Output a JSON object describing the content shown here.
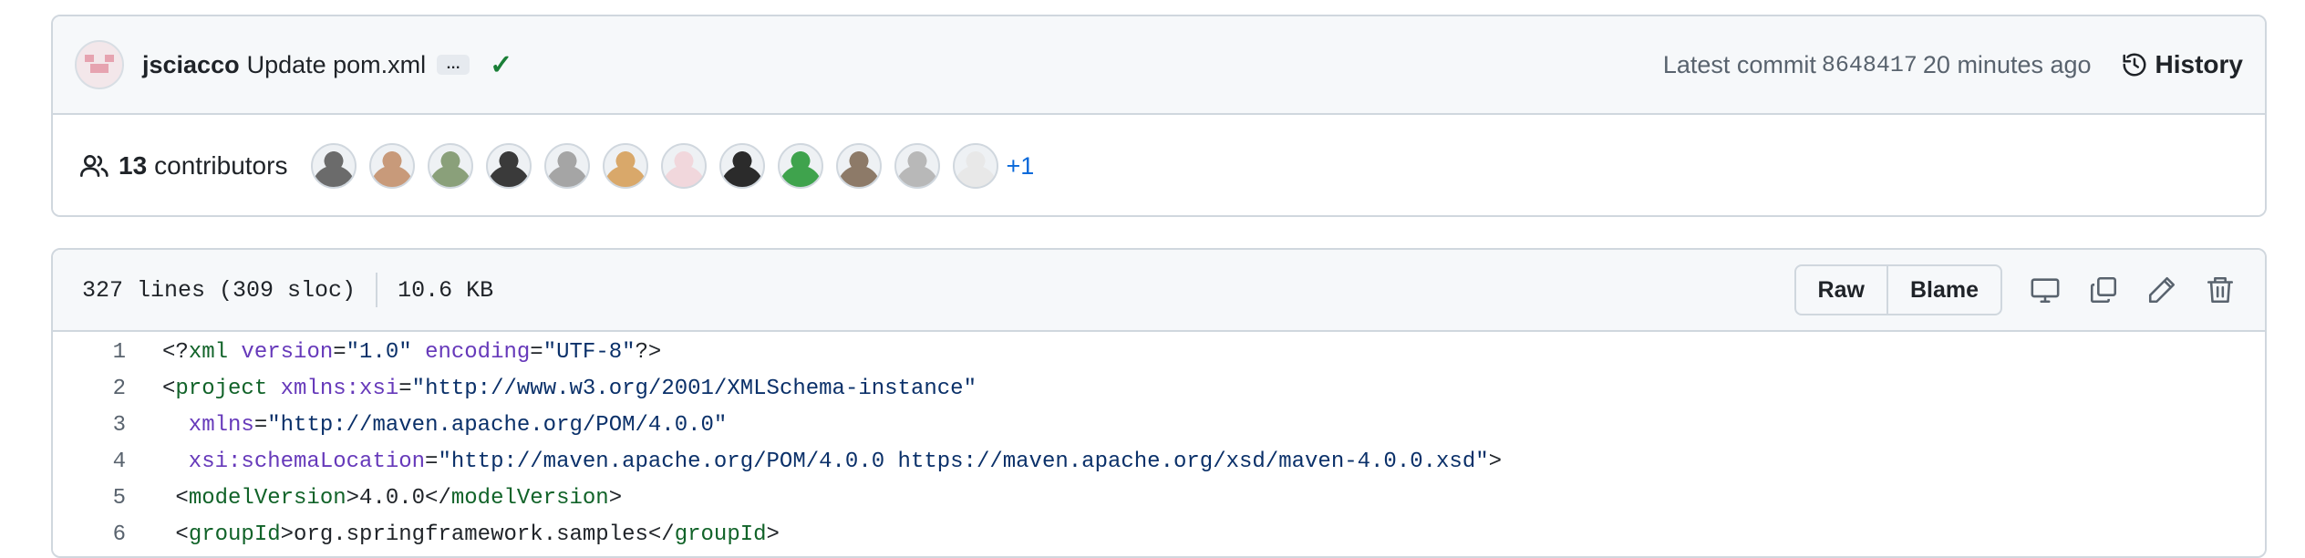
{
  "commit": {
    "author": "jsciacco",
    "message": "Update pom.xml",
    "ellipsis": "…",
    "latest_label": "Latest commit",
    "sha": "8648417",
    "time": "20 minutes ago",
    "history_label": "History"
  },
  "contributors": {
    "count": "13",
    "label": "contributors",
    "more": "+1",
    "avatar_colors": [
      "#6b6b6b",
      "#c89a7a",
      "#8aa07a",
      "#3a3a3a",
      "#a5a5a5",
      "#d9a86a",
      "#f1d7dc",
      "#2b2b2b",
      "#3fa34d",
      "#8d7a68",
      "#b8b8b8",
      "#e8e8e8"
    ]
  },
  "file": {
    "lines_info": "327 lines (309 sloc)",
    "size": "10.6 KB",
    "raw_label": "Raw",
    "blame_label": "Blame"
  },
  "code_lines": [
    {
      "n": "1"
    },
    {
      "n": "2"
    },
    {
      "n": "3"
    },
    {
      "n": "4"
    },
    {
      "n": "5"
    },
    {
      "n": "6"
    }
  ],
  "code_text": {
    "l1_a": "<?",
    "l1_b": "xml",
    "l1_c": " version",
    "l1_d": "=",
    "l1_e": "\"1.0\"",
    "l1_f": " encoding",
    "l1_g": "=",
    "l1_h": "\"UTF-8\"",
    "l1_i": "?>",
    "l2_a": "<",
    "l2_b": "project",
    "l2_c": " xmlns:xsi",
    "l2_d": "=",
    "l2_e": "\"http://www.w3.org/2001/XMLSchema-instance\"",
    "l3_a": "  xmlns",
    "l3_b": "=",
    "l3_c": "\"http://maven.apache.org/POM/4.0.0\"",
    "l4_a": "  xsi:schemaLocation",
    "l4_b": "=",
    "l4_c": "\"http://maven.apache.org/POM/4.0.0 https://maven.apache.org/xsd/maven-4.0.0.xsd\"",
    "l4_d": ">",
    "l5_a": " <",
    "l5_b": "modelVersion",
    "l5_c": ">4.0.0</",
    "l5_d": "modelVersion",
    "l5_e": ">",
    "l6_a": " <",
    "l6_b": "groupId",
    "l6_c": ">org.springframework.samples</",
    "l6_d": "groupId",
    "l6_e": ">"
  }
}
